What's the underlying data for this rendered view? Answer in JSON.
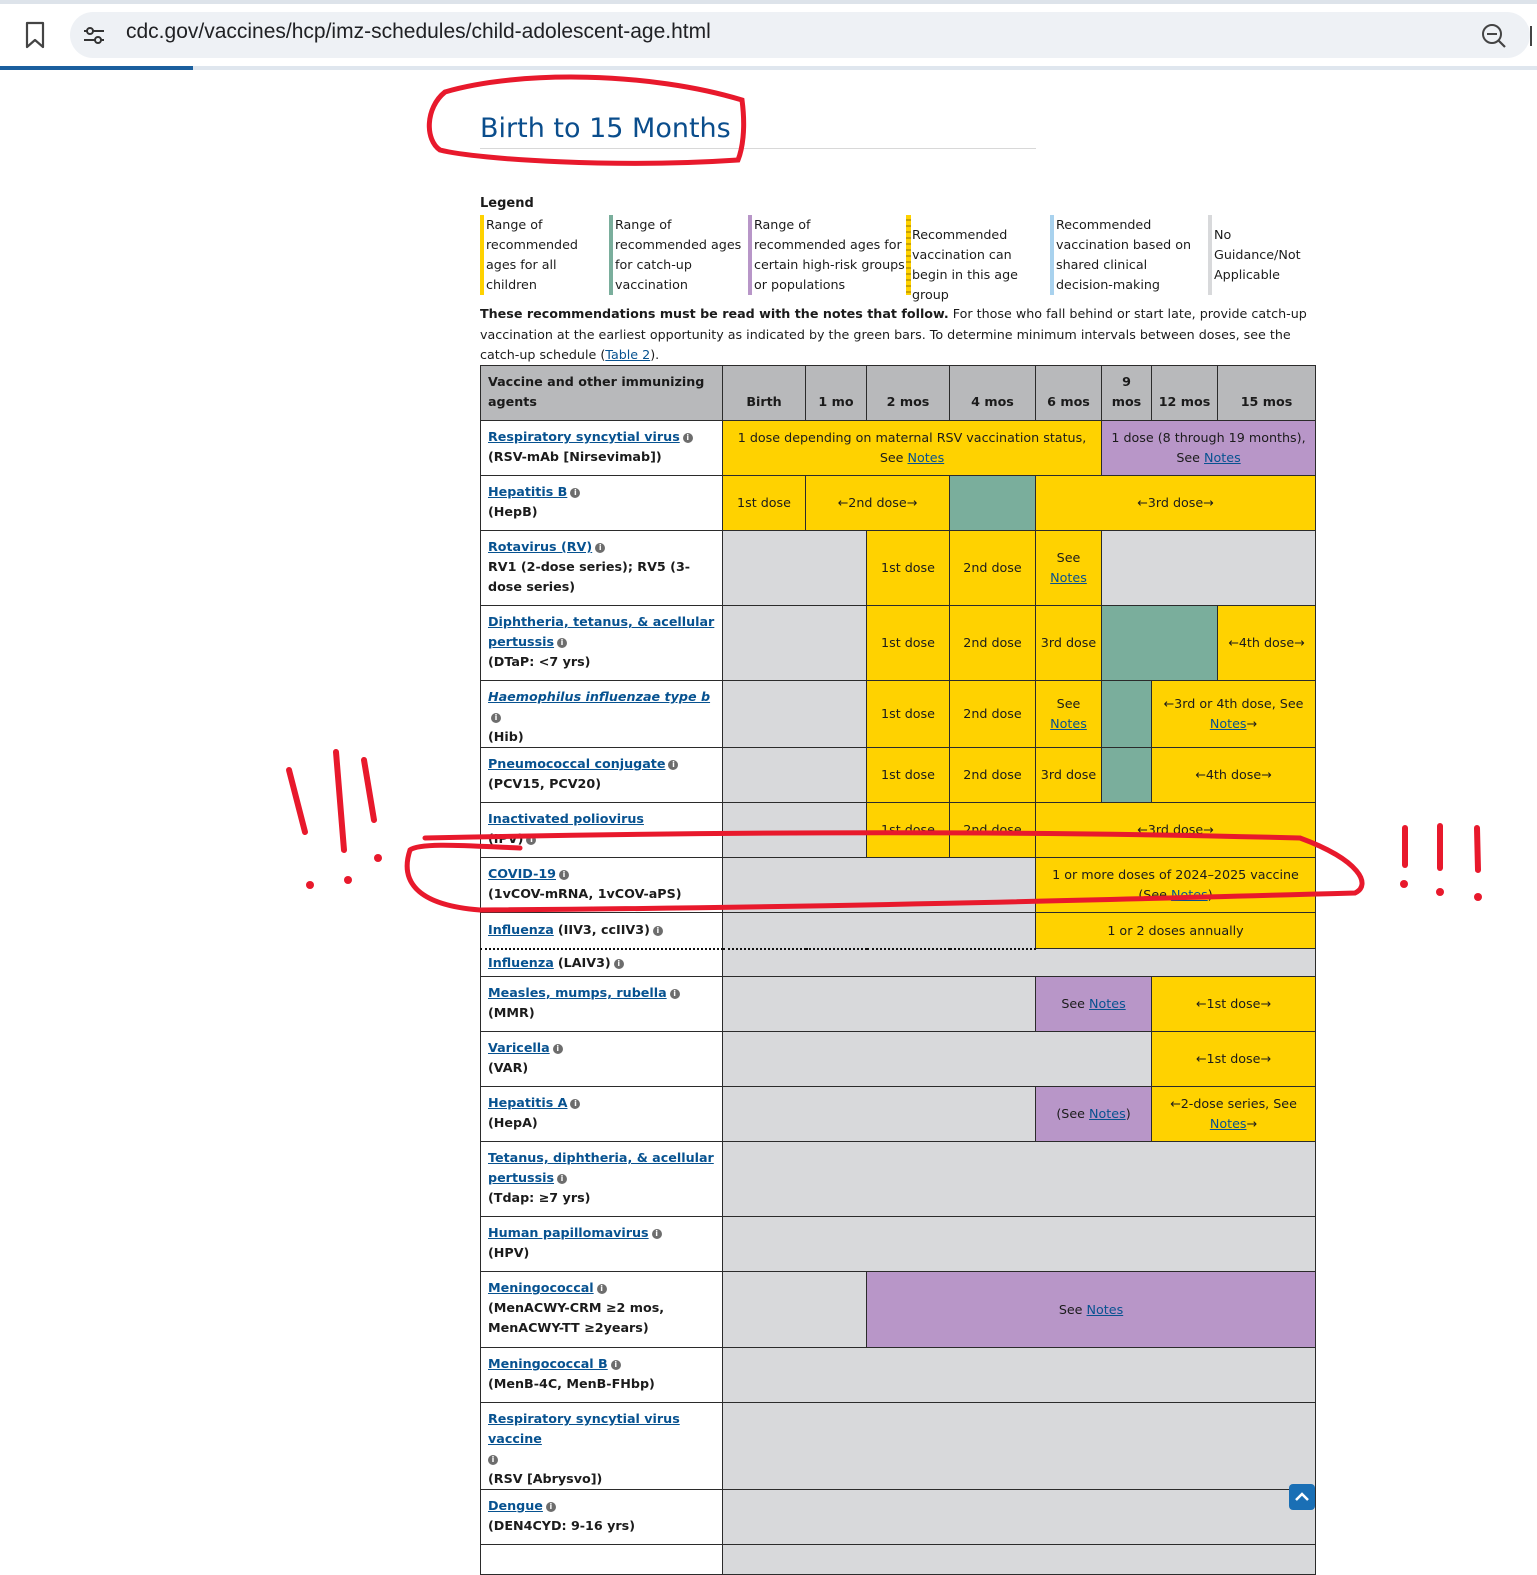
{
  "browser": {
    "url": "cdc.gov/vaccines/hcp/imz-schedules/child-adolescent-age.html"
  },
  "heading": "Birth to 15 Months",
  "legend": {
    "title": "Legend",
    "items": [
      {
        "text": "Range of recommended ages for all children",
        "color": "#ffd200"
      },
      {
        "text": "Range of recommended ages for catch-up vaccination",
        "color": "#7aae9c"
      },
      {
        "text": "Range of recommended ages for certain high-risk groups or populations",
        "color": "#b896c8"
      },
      {
        "text": "Recommended vaccination can begin in this age group",
        "color": "#ffd200"
      },
      {
        "text": "Recommended vaccination based on shared clinical decision-making",
        "color": "#a9d2ee"
      },
      {
        "text": "No Guidance/Not Applicable",
        "color": "#d8d9db"
      }
    ]
  },
  "notice": {
    "bold": "These recommendations must be read with the notes that follow.",
    "text": " For those who fall behind or start late, provide catch-up vaccination at the earliest opportunity as indicated by the green bars. To determine minimum intervals between doses, see the catch-up schedule (",
    "link": "Table 2",
    "end": ")."
  },
  "table": {
    "headers": [
      "Vaccine and other immunizing agents",
      "Birth",
      "1 mo",
      "2 mos",
      "4 mos",
      "6 mos",
      "9 mos",
      "12 mos",
      "15 mos"
    ],
    "vaccines": [
      {
        "name": "Respiratory syncytial virus",
        "sub": "(RSV-mAb [Nirsevimab])"
      },
      {
        "name": "Hepatitis B",
        "sub": "(HepB)"
      },
      {
        "name": "Rotavirus (RV)",
        "sub": "RV1 (2-dose series); RV5 (3-dose series)"
      },
      {
        "name": "Diphtheria, tetanus, & acellular pertussis",
        "sub": "(DTaP: <7 yrs)"
      },
      {
        "name": "Haemophilus influenzae type b",
        "sub": "(Hib)"
      },
      {
        "name": "Pneumococcal conjugate",
        "sub": "(PCV15, PCV20)"
      },
      {
        "name": "Inactivated poliovirus",
        "sub": "(IPV)"
      },
      {
        "name": "COVID-19",
        "sub": "(1vCOV-mRNA, 1vCOV-aPS)"
      },
      {
        "name": "Influenza",
        "sub": "(IIV3, ccIIV3)"
      },
      {
        "name": "Influenza",
        "sub": "(LAIV3)"
      },
      {
        "name": "Measles, mumps, rubella",
        "sub": "(MMR)"
      },
      {
        "name": "Varicella",
        "sub": "(VAR)"
      },
      {
        "name": "Hepatitis A",
        "sub": "(HepA)"
      },
      {
        "name": "Tetanus, diphtheria, & acellular pertussis",
        "sub": "(Tdap: ≥7 yrs)"
      },
      {
        "name": "Human papillomavirus",
        "sub": "(HPV)"
      },
      {
        "name": "Meningococcal",
        "sub": "(MenACWY-CRM ≥2 mos, MenACWY-TT ≥2years)"
      },
      {
        "name": "Meningococcal B",
        "sub": "(MenB-4C, MenB-FHbp)"
      },
      {
        "name": "Respiratory syncytial virus vaccine",
        "sub": "(RSV [Abrysvo])"
      },
      {
        "name": "Dengue",
        "sub": "(DEN4CYD: 9-16 yrs)"
      }
    ],
    "cells": {
      "rsv_a": "1 dose depending on maternal RSV vaccination status, See",
      "rsv_b": "1 dose (8 through 19 months), See",
      "notes": "Notes",
      "see": "See",
      "dose1": "1st dose",
      "dose2": "2nd dose",
      "dose3": "3rd dose",
      "hepb_2": "←2nd dose→",
      "dose3_range": "←3rd dose→",
      "dose4_range": "←4th dose→",
      "hib_range": "←3rd or 4th dose, See",
      "covid": "1 or more doses of 2024–2025 vaccine",
      "covid_see": "(See",
      "flu": "1 or 2 doses annually",
      "mmr_range": "←1st dose→",
      "hepa_see": "(See",
      "hepa_range": "←2-dose series, See"
    }
  },
  "annotations": {
    "exclaim": "!!!"
  }
}
